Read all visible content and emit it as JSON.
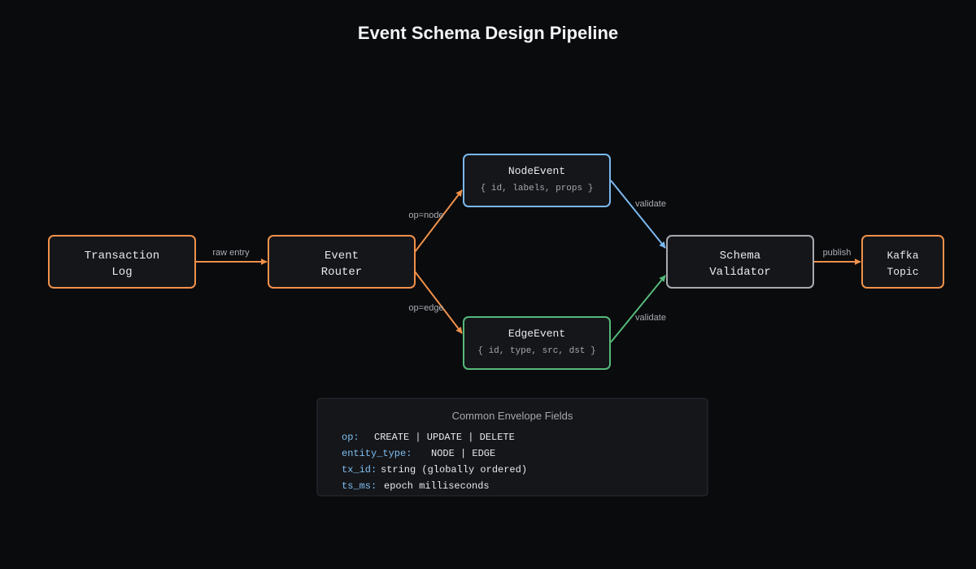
{
  "title": "Event Schema Design Pipeline",
  "colors": {
    "orange": "#f0914a",
    "blue": "#7ab8ee",
    "green": "#55b97a",
    "gray": "#a7aaaf"
  },
  "nodes": {
    "transaction_log": {
      "line1": "Transaction",
      "line2": "Log"
    },
    "event_router": {
      "line1": "Event",
      "line2": "Router"
    },
    "node_event": {
      "name": "NodeEvent",
      "fields": "{ id, labels, props }"
    },
    "edge_event": {
      "name": "EdgeEvent",
      "fields": "{ id, type, src, dst }"
    },
    "schema_validator": {
      "line1": "Schema",
      "line2": "Validator"
    },
    "kafka_topic": {
      "line1": "Kafka",
      "line2": "Topic"
    }
  },
  "edges": {
    "raw_entry": "raw entry",
    "op_node": "op=node",
    "op_edge": "op=edge",
    "validate_node": "validate",
    "validate_edge": "validate",
    "publish": "publish"
  },
  "envelope": {
    "title": "Common Envelope Fields",
    "fields": [
      {
        "key": "op:",
        "value": "CREATE | UPDATE | DELETE"
      },
      {
        "key": "entity_type:",
        "value": "NODE | EDGE"
      },
      {
        "key": "tx_id:",
        "value": "string (globally ordered)"
      },
      {
        "key": "ts_ms:",
        "value": "epoch milliseconds"
      }
    ]
  }
}
